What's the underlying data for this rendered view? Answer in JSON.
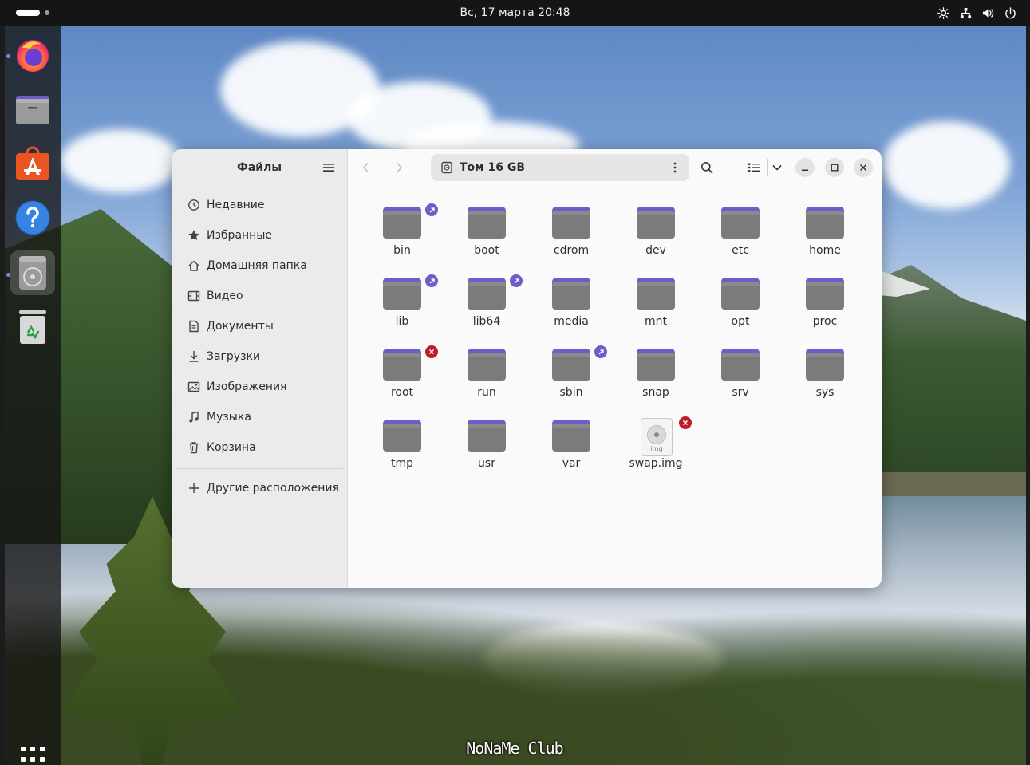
{
  "topbar": {
    "clock": "Вс, 17 марта  20:48",
    "tray_icons": [
      "brightness-icon",
      "network-icon",
      "volume-icon",
      "power-icon"
    ]
  },
  "dock": {
    "apps": [
      {
        "name": "firefox-icon",
        "running": true,
        "active": false
      },
      {
        "name": "files-icon",
        "running": false,
        "active": false
      },
      {
        "name": "app-center-icon",
        "running": false,
        "active": false
      },
      {
        "name": "help-icon",
        "running": false,
        "active": false
      },
      {
        "name": "disk-app-icon",
        "running": true,
        "active": true
      },
      {
        "name": "trash-icon",
        "running": false,
        "active": false
      }
    ],
    "show_apps_icon": "apps-grid-icon"
  },
  "window": {
    "sidebar": {
      "title": "Файлы",
      "places": [
        {
          "label": "Недавние",
          "icon": "clock-icon"
        },
        {
          "label": "Избранные",
          "icon": "star-icon"
        },
        {
          "label": "Домашняя папка",
          "icon": "home-icon"
        },
        {
          "label": "Видео",
          "icon": "film-icon"
        },
        {
          "label": "Документы",
          "icon": "document-icon"
        },
        {
          "label": "Загрузки",
          "icon": "download-icon"
        },
        {
          "label": "Изображения",
          "icon": "image-icon"
        },
        {
          "label": "Музыка",
          "icon": "music-icon"
        },
        {
          "label": "Корзина",
          "icon": "trash-icon"
        }
      ],
      "other_locations": "Другие расположения"
    },
    "path": {
      "label": "Том 16 GB",
      "icon": "drive-icon"
    },
    "items": [
      {
        "name": "bin",
        "type": "folder",
        "emblem": "link"
      },
      {
        "name": "boot",
        "type": "folder",
        "emblem": ""
      },
      {
        "name": "cdrom",
        "type": "folder",
        "emblem": ""
      },
      {
        "name": "dev",
        "type": "folder",
        "emblem": ""
      },
      {
        "name": "etc",
        "type": "folder",
        "emblem": ""
      },
      {
        "name": "home",
        "type": "folder",
        "emblem": ""
      },
      {
        "name": "lib",
        "type": "folder",
        "emblem": "link"
      },
      {
        "name": "lib64",
        "type": "folder",
        "emblem": "link"
      },
      {
        "name": "media",
        "type": "folder",
        "emblem": ""
      },
      {
        "name": "mnt",
        "type": "folder",
        "emblem": ""
      },
      {
        "name": "opt",
        "type": "folder",
        "emblem": ""
      },
      {
        "name": "proc",
        "type": "folder",
        "emblem": ""
      },
      {
        "name": "root",
        "type": "folder",
        "emblem": "denied"
      },
      {
        "name": "run",
        "type": "folder",
        "emblem": ""
      },
      {
        "name": "sbin",
        "type": "folder",
        "emblem": "link"
      },
      {
        "name": "snap",
        "type": "folder",
        "emblem": ""
      },
      {
        "name": "srv",
        "type": "folder",
        "emblem": ""
      },
      {
        "name": "sys",
        "type": "folder",
        "emblem": ""
      },
      {
        "name": "tmp",
        "type": "folder",
        "emblem": ""
      },
      {
        "name": "usr",
        "type": "folder",
        "emblem": ""
      },
      {
        "name": "var",
        "type": "folder",
        "emblem": ""
      },
      {
        "name": "swap.img",
        "type": "file",
        "ext_label": "img",
        "emblem": "denied"
      }
    ]
  },
  "watermark": "NoNaMe Club",
  "colors": {
    "folder_tab": "#6b5ec9",
    "folder_body": "#7b7b7b",
    "emblem_link": "#6b5ec9",
    "emblem_denied": "#c01c28",
    "accent": "#e95420"
  }
}
